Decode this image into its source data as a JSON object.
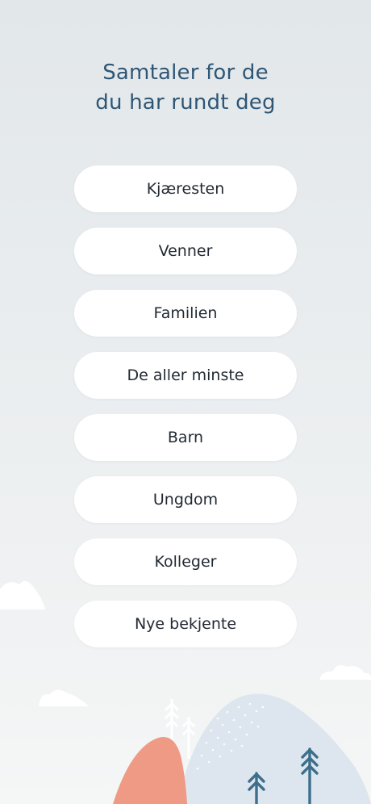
{
  "header": {
    "title_line1": "Samtaler for de",
    "title_line2": "du har rundt deg"
  },
  "options": [
    {
      "label": "Kjæresten"
    },
    {
      "label": "Venner"
    },
    {
      "label": "Familien"
    },
    {
      "label": "De aller minste"
    },
    {
      "label": "Barn"
    },
    {
      "label": "Ungdom"
    },
    {
      "label": "Kolleger"
    },
    {
      "label": "Nye bekjente"
    }
  ],
  "colors": {
    "title": "#2f5674",
    "button_bg": "#ffffff",
    "button_text": "#222a33",
    "hill_coral": "#ef9a85",
    "hill_blue": "#dde6ee",
    "tree": "#3d6f8c"
  },
  "illustration": {
    "icons": [
      "cloud-icon",
      "hill-icon",
      "tree-icon"
    ]
  }
}
